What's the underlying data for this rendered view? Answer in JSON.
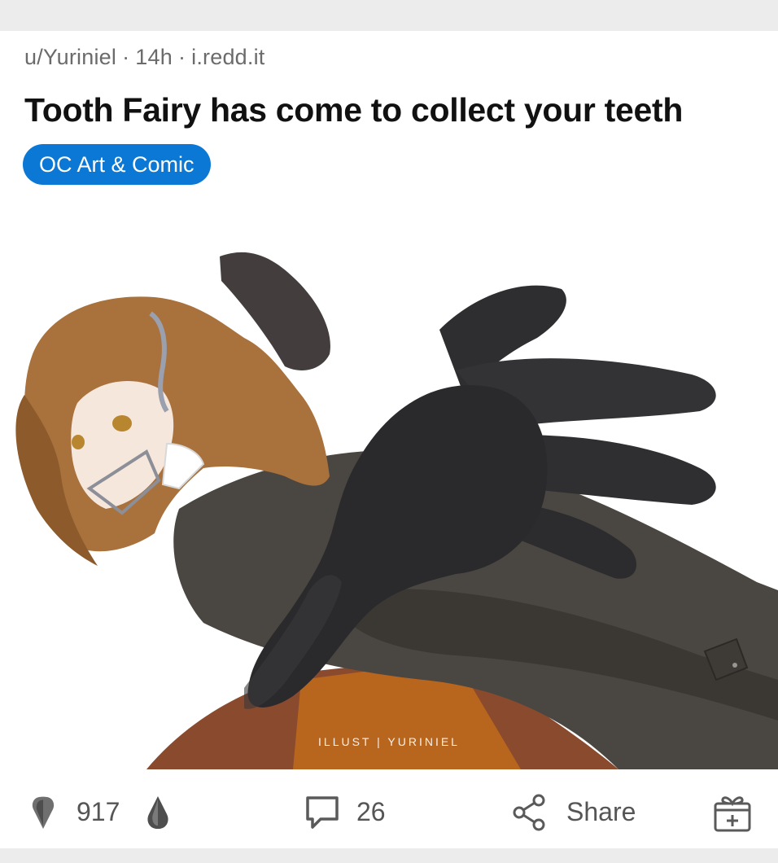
{
  "post": {
    "author": "u/Yuriniel",
    "age": "14h",
    "domain": "i.redd.it",
    "separator": "·",
    "title": "Tooth Fairy has come to collect your teeth",
    "flair": "OC Art & Comic",
    "image_watermark": "ILLUST | YURINIEL",
    "image_alt": "Anime-style illustration of a tooth fairy with wavy brown hair, dental braces headgear, dark coat, reaching out with a large black gloved hand"
  },
  "actions": {
    "votes": "917",
    "comments": "26",
    "share_label": "Share"
  },
  "icons": {
    "upvote": "upvote-icon",
    "downvote": "downvote-icon",
    "comment": "comment-bubble-icon",
    "share": "share-icon",
    "award": "award-gift-icon"
  },
  "colors": {
    "flair_bg": "#0a78d4",
    "text_primary": "#111111",
    "text_secondary": "#6b6b6b"
  }
}
